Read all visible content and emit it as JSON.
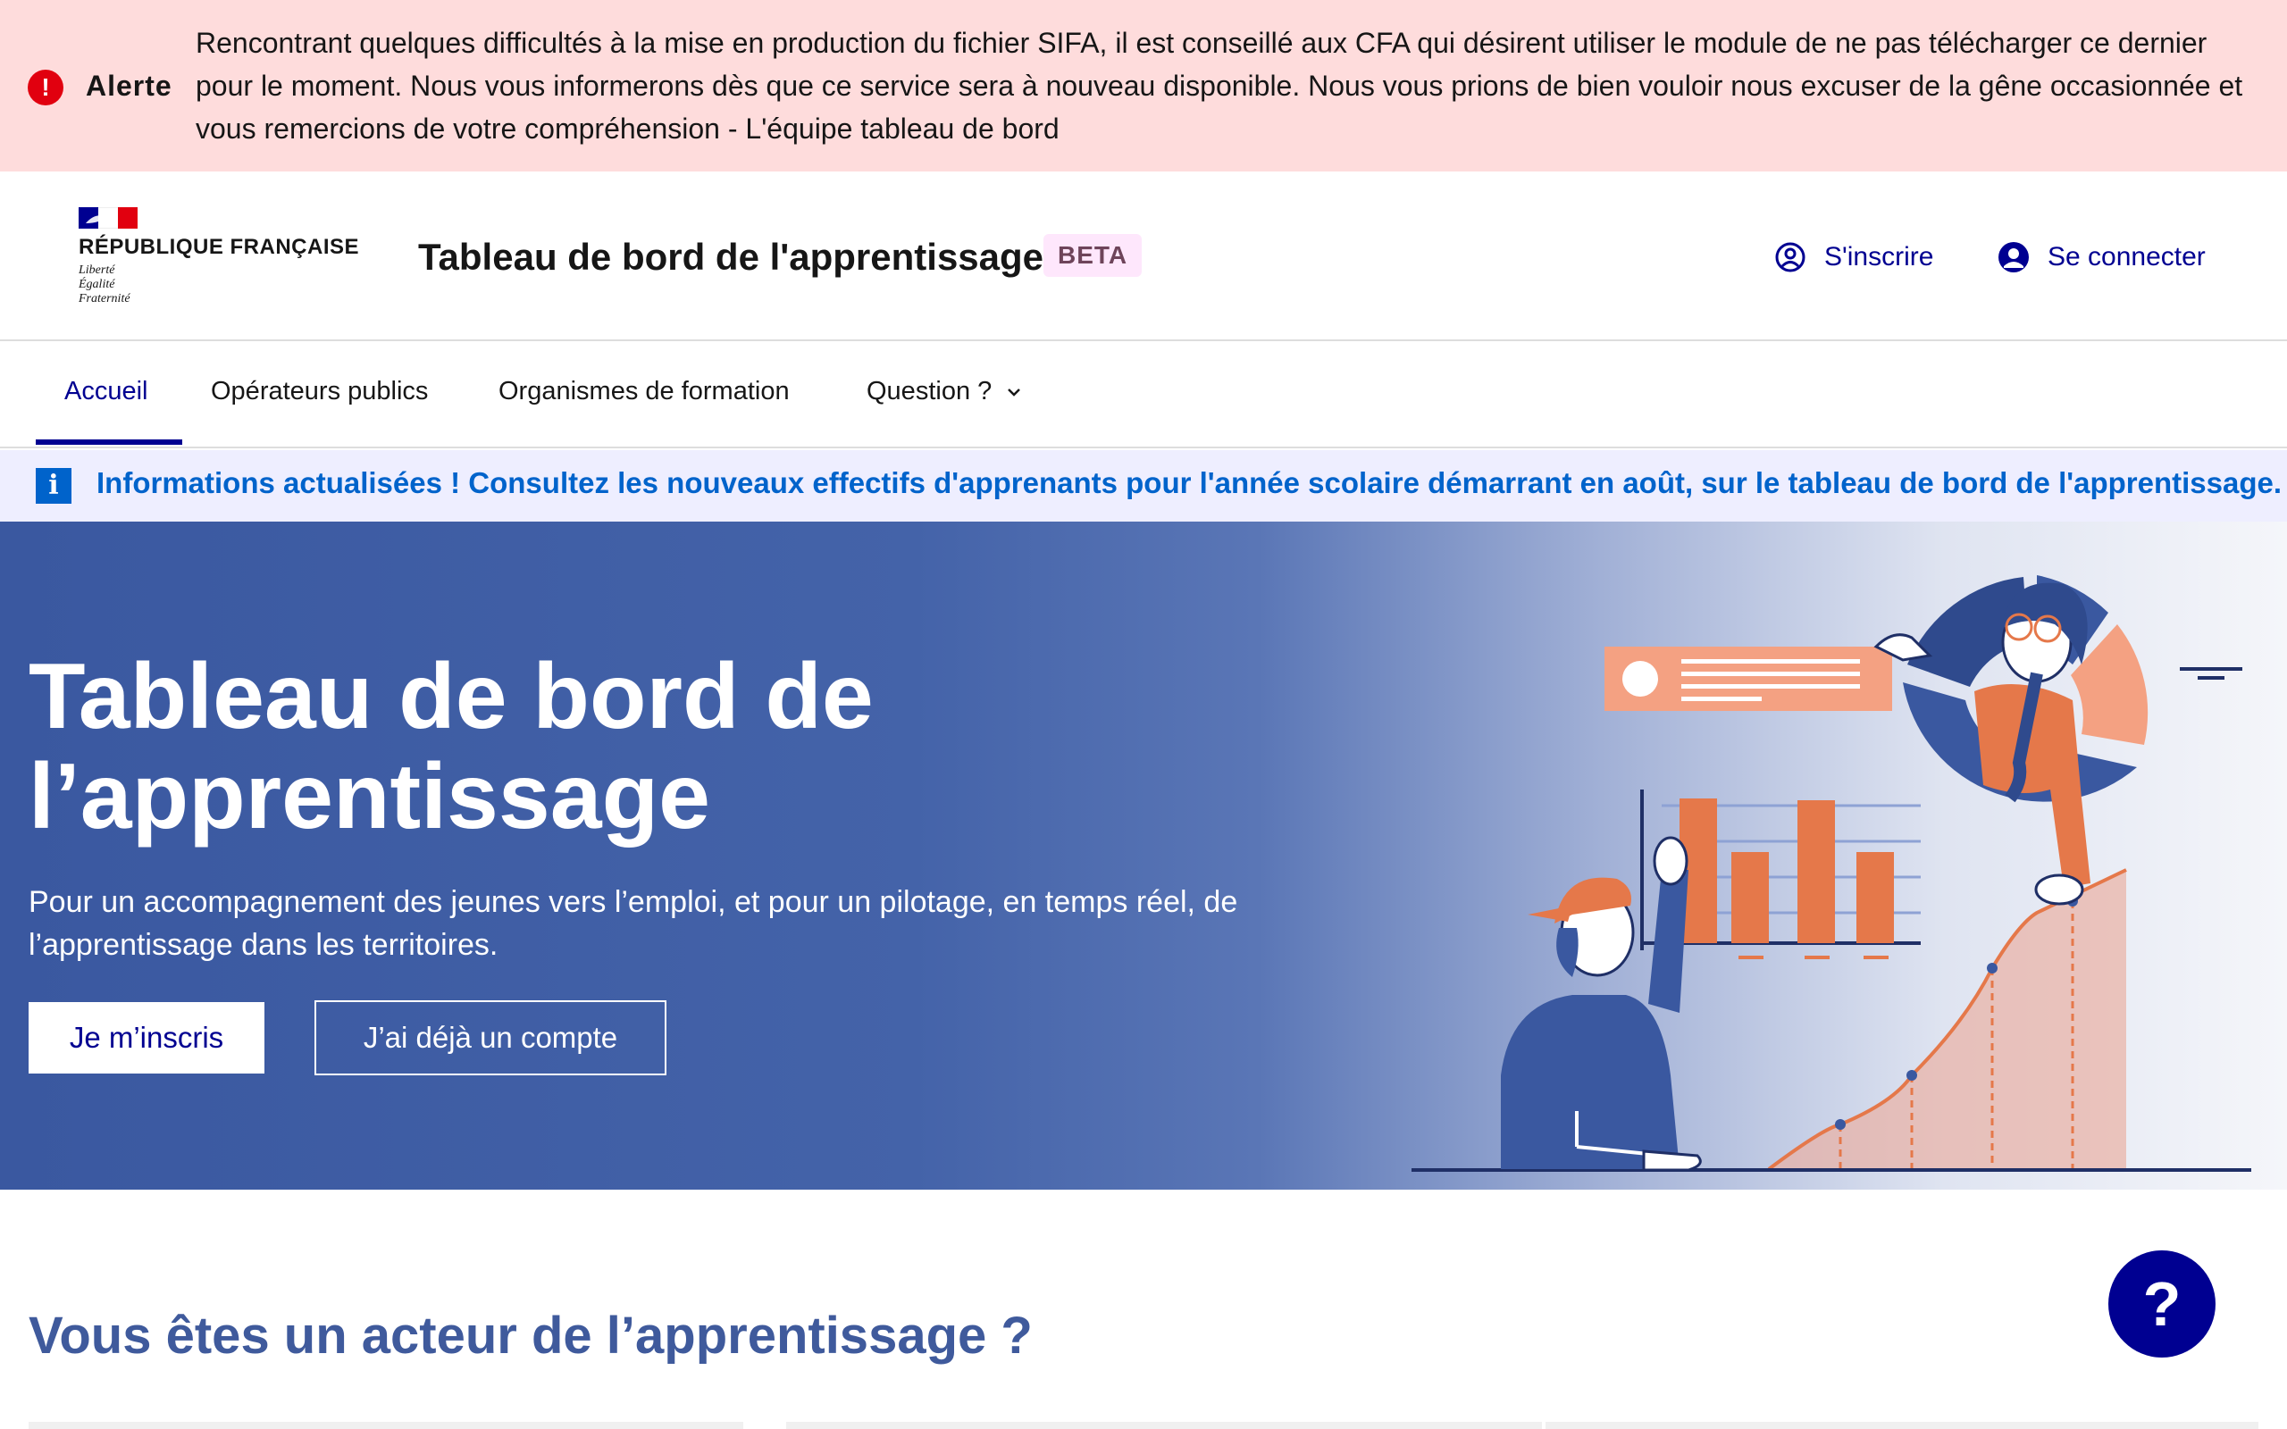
{
  "alert": {
    "icon": "alert-exclamation-icon",
    "title": "Alerte",
    "message": "Rencontrant quelques difficultés à la mise en production du fichier SIFA, il est conseillé aux CFA qui désirent utiliser le module de ne pas télécharger ce dernier pour le moment. Nous vous informerons dès que ce service sera à nouveau disponible. Nous vous prions de bien vouloir nous excuser de la gêne occasionnée et vous remercions de votre compréhension - L'équipe tableau de bord"
  },
  "header": {
    "brand": {
      "name": "RÉPUBLIQUE FRANÇAISE",
      "motto": [
        "Liberté",
        "Égalité",
        "Fraternité"
      ]
    },
    "site_title": "Tableau de bord de l'apprentissage",
    "badge": "BETA",
    "links": [
      {
        "label": "S'inscrire",
        "icon": "user-circle-outline-icon"
      },
      {
        "label": "Se connecter",
        "icon": "user-circle-filled-icon"
      }
    ]
  },
  "nav": {
    "items": [
      {
        "label": "Accueil",
        "active": true
      },
      {
        "label": "Opérateurs publics",
        "active": false
      },
      {
        "label": "Organismes de formation",
        "active": false
      },
      {
        "label": "Question ?",
        "active": false,
        "dropdown": true
      }
    ]
  },
  "notice": {
    "icon": "info-icon",
    "text": "Informations actualisées ! Consultez les nouveaux effectifs d'apprenants pour l'année scolaire démarrant en août, sur le tableau de bord de l'apprentissage."
  },
  "hero": {
    "title_line1": "Tableau de bord de",
    "title_line2": "l’apprentissage",
    "subtitle": "Pour un accompagnement des jeunes vers l’emploi, et pour un pilotage, en temps réel, de l’apprentissage dans les territoires.",
    "primary_button": "Je m’inscris",
    "secondary_button": "J’ai déjà un compte"
  },
  "section": {
    "title": "Vous êtes un acteur de l’apprentissage ?"
  },
  "help": {
    "label": "?",
    "icon": "help-question-icon"
  },
  "colors": {
    "brand_blue": "#000091",
    "alert_bg": "#fedcdc",
    "info_blue": "#0063cb",
    "hero_blue": "#3a58a0",
    "accent_orange": "#e5784a"
  }
}
